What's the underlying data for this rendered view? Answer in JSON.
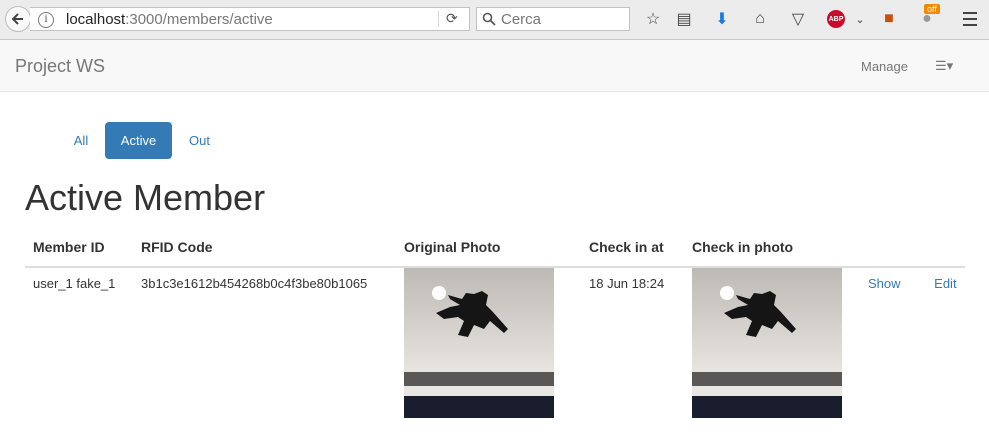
{
  "browser": {
    "url_host": "localhost",
    "url_path": ":3000/members/active",
    "search_placeholder": "Cerca",
    "addon_badge": "off"
  },
  "navbar": {
    "brand": "Project WS",
    "manage": "Manage"
  },
  "pills": [
    {
      "label": "All",
      "active": false
    },
    {
      "label": "Active",
      "active": true
    },
    {
      "label": "Out",
      "active": false
    }
  ],
  "page_title": "Active Member",
  "table": {
    "headers": [
      "Member ID",
      "RFID Code",
      "Original Photo",
      "Check in at",
      "Check in photo"
    ],
    "rows": [
      {
        "member_id": "user_1 fake_1",
        "rfid": "3b1c3e1612b454268b0c4f3be80b1065",
        "check_in_at": "18 Jun 18:24",
        "show": "Show",
        "edit": "Edit"
      }
    ]
  },
  "colors": {
    "primary": "#337ab7",
    "navbar_bg": "#f8f8f8"
  }
}
